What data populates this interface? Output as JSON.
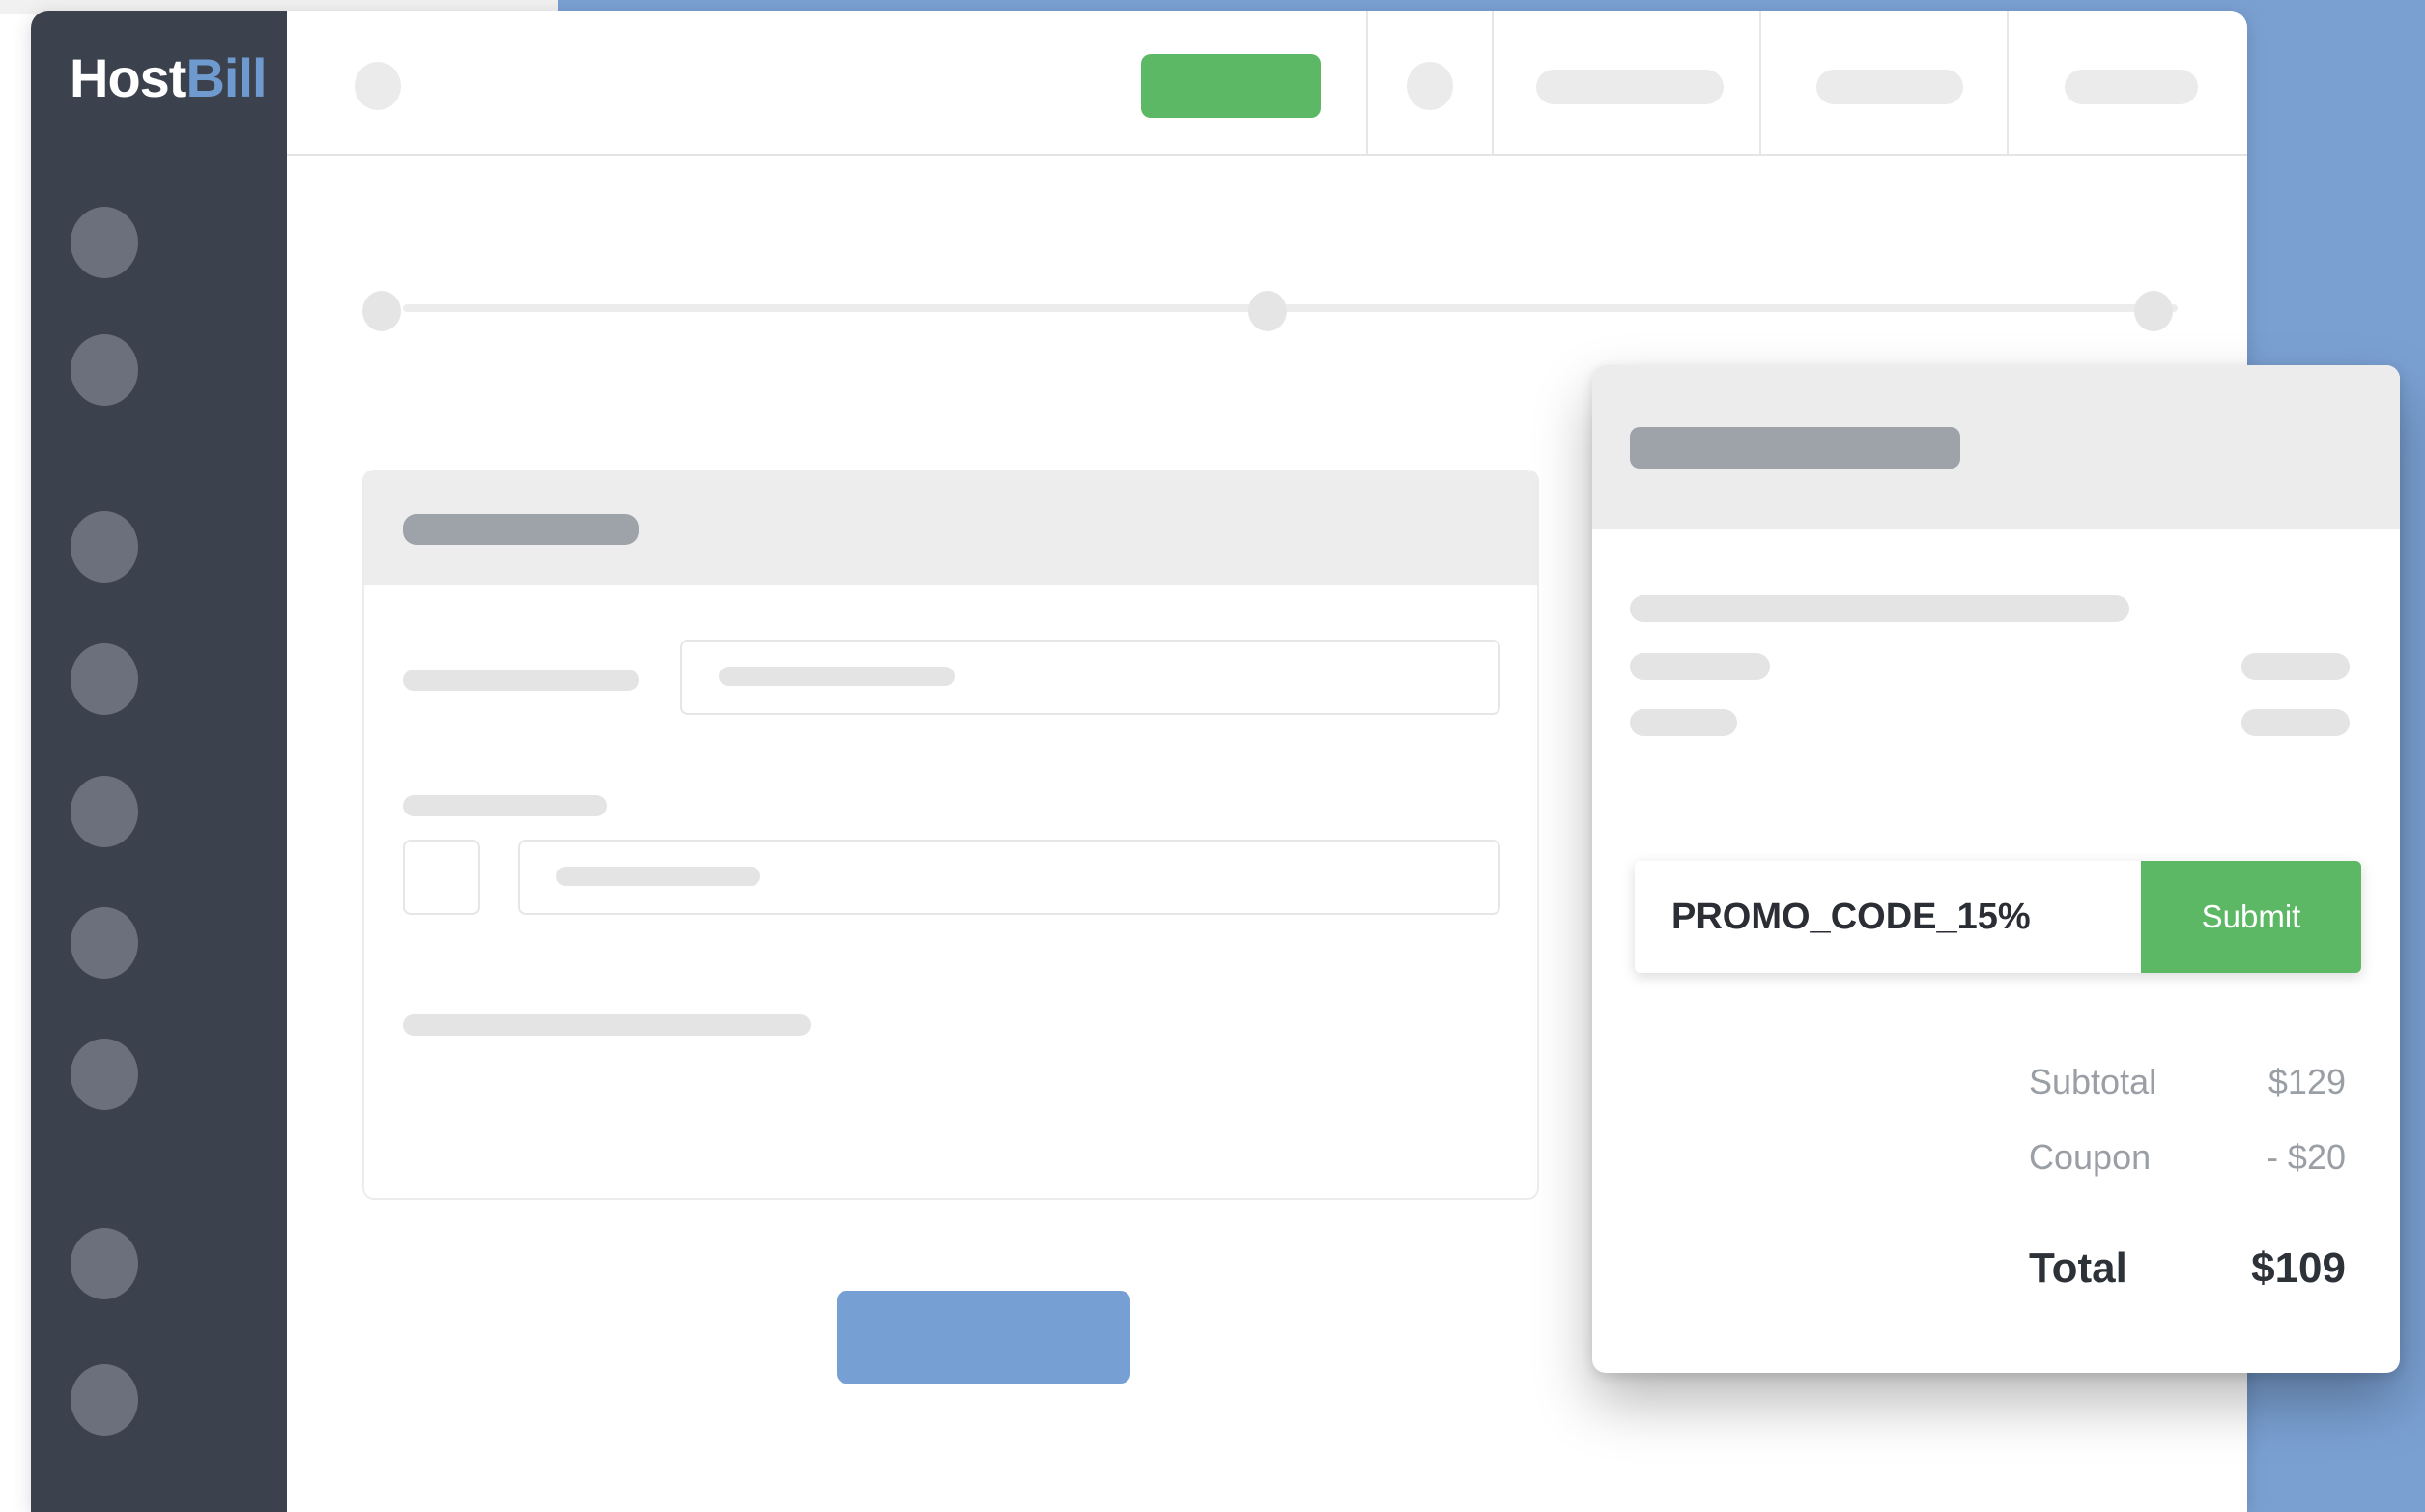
{
  "brand": {
    "logo_part1": "Host",
    "logo_part2": "Bill",
    "accent_color": "#6f9ad0",
    "sidebar_color": "#3c424d",
    "success_color": "#5cb865",
    "background_color": "#7aa0d2"
  },
  "sidebar": {
    "item_count": 9
  },
  "checkout": {
    "promo_input_value": "PROMO_CODE_15%",
    "submit_label": "Submit",
    "summary": {
      "subtotal_label": "Subtotal",
      "subtotal_value": "$129",
      "coupon_label": "Coupon",
      "coupon_value": "- $20",
      "total_label": "Total",
      "total_value": "$109"
    }
  }
}
